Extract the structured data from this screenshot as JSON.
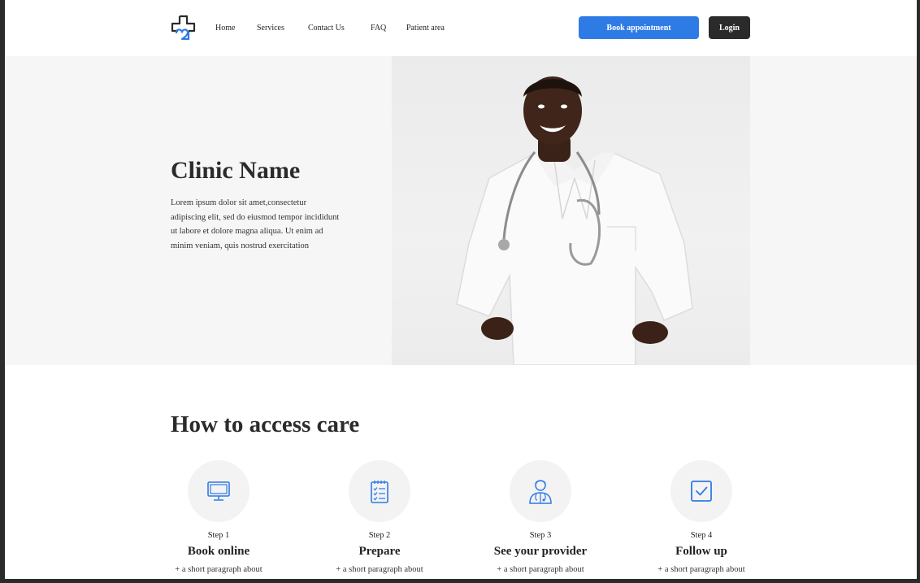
{
  "nav": {
    "items": [
      {
        "label": "Home"
      },
      {
        "label": "Services"
      },
      {
        "label": "Contact Us"
      },
      {
        "label": "FAQ"
      },
      {
        "label": "Patient area"
      }
    ],
    "book_label": "Book appointment",
    "login_label": "Login"
  },
  "hero": {
    "title": "Clinic Name",
    "text": "Lorem ipsum dolor sit amet,consectetur adipiscing elit, sed do eiusmod tempor incididunt ut labore et dolore magna aliqua. Ut enim ad minim veniam, quis nostrud exercitation"
  },
  "steps_section": {
    "title": "How to access care",
    "steps": [
      {
        "icon": "monitor-icon",
        "step": "Step 1",
        "title": "Book online",
        "text": "+ a short paragraph about"
      },
      {
        "icon": "checklist-icon",
        "step": "Step 2",
        "title": "Prepare",
        "text": "+ a short paragraph about"
      },
      {
        "icon": "doctor-icon",
        "step": "Step 3",
        "title": "See your provider",
        "text": "+ a short paragraph about"
      },
      {
        "icon": "checkbox-icon",
        "step": "Step 4",
        "title": "Follow up",
        "text": "+ a short paragraph about"
      }
    ]
  },
  "colors": {
    "accent": "#2f7be5",
    "dark": "#2b2b2b",
    "hero_bg": "#f6f6f6"
  }
}
